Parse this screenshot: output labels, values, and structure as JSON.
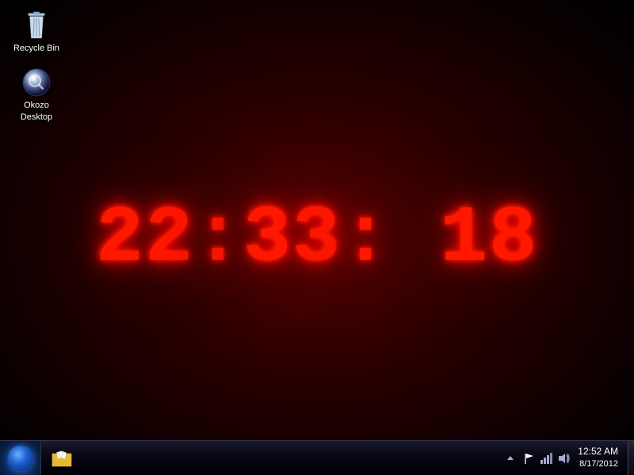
{
  "desktop": {
    "background": "dark red radial gradient"
  },
  "icons": [
    {
      "id": "recycle-bin",
      "label": "Recycle Bin",
      "type": "recycle-bin"
    },
    {
      "id": "okozo-desktop",
      "label": "Okozo\nDesktop",
      "label_line1": "Okozo",
      "label_line2": "Desktop",
      "type": "okozo"
    }
  ],
  "clock": {
    "display": "22:33: 18",
    "hours": "22",
    "minutes": "33",
    "seconds": "18"
  },
  "taskbar": {
    "start_label": "Start",
    "pinned_icons": [
      {
        "name": "file-explorer",
        "label": "Windows Explorer"
      }
    ],
    "tray": {
      "time": "12:52 AM",
      "date": "8/17/2012",
      "icons": [
        "up-arrow",
        "flag",
        "network",
        "volume",
        "speaker"
      ]
    }
  }
}
